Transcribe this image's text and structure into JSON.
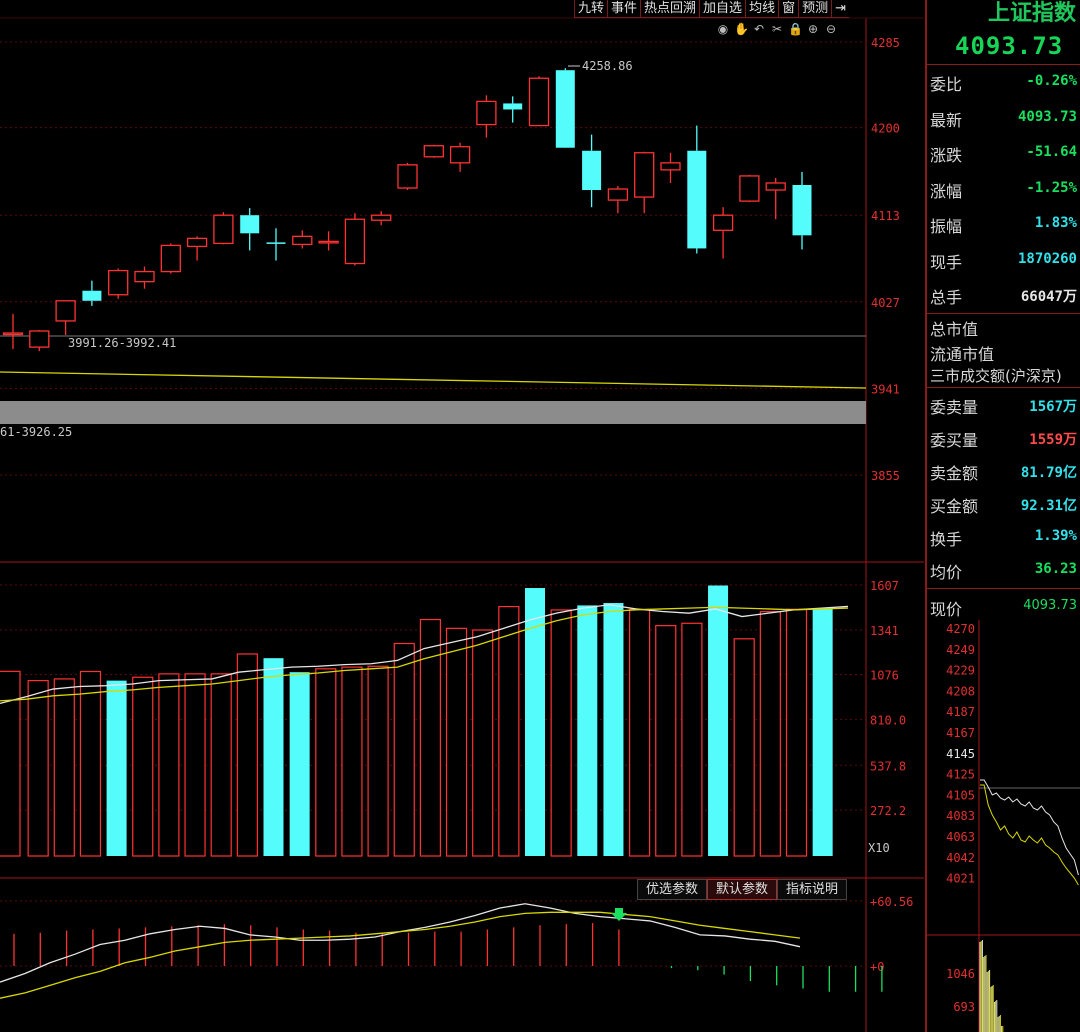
{
  "toolbar": {
    "buttons": [
      "九转",
      "事件",
      "热点回溯",
      "加自选",
      "均线",
      "窗",
      "预测"
    ],
    "arrow": "⇥"
  },
  "zoom_tools": [
    "eye-icon",
    "hand-icon",
    "undo-icon",
    "scissors-icon",
    "lock-icon",
    "zoom-in-icon",
    "zoom-out-icon"
  ],
  "main_axis_labels": [
    "4285",
    "4200",
    "4113",
    "4027",
    "3941",
    "3855"
  ],
  "annotations": {
    "high": "4258.86",
    "gap1": "3991.26-3992.41",
    "gap2": "61-3926.25"
  },
  "volume_axis_labels": [
    "1607",
    "1341",
    "1076",
    "810.0",
    "537.8",
    "272.2"
  ],
  "volume_unit": "X10",
  "macd_axis_labels": [
    "+60.56",
    "+0"
  ],
  "param_buttons": [
    "优选参数",
    "默认参数",
    "指标说明"
  ],
  "chart_data": {
    "type": "candlestick",
    "price_range": [
      3799,
      4310
    ],
    "candles": [
      {
        "o": 3996,
        "h": 4015,
        "l": 3980,
        "c": 3996
      },
      {
        "o": 3998,
        "h": 3999,
        "l": 3978,
        "c": 3982
      },
      {
        "o": 4008,
        "h": 4028,
        "l": 3994,
        "c": 4028
      },
      {
        "o": 4028,
        "h": 4048,
        "l": 4023,
        "c": 4038,
        "color": "cyan"
      },
      {
        "o": 4034,
        "h": 4060,
        "l": 4030,
        "c": 4058
      },
      {
        "o": 4047,
        "h": 4062,
        "l": 4040,
        "c": 4057
      },
      {
        "o": 4057,
        "h": 4085,
        "l": 4055,
        "c": 4083
      },
      {
        "o": 4082,
        "h": 4092,
        "l": 4068,
        "c": 4090
      },
      {
        "o": 4085,
        "h": 4116,
        "l": 4084,
        "c": 4113
      },
      {
        "o": 4113,
        "h": 4120,
        "l": 4078,
        "c": 4095,
        "color": "cyan"
      },
      {
        "o": 4086,
        "h": 4100,
        "l": 4068,
        "c": 4086,
        "color": "cyan"
      },
      {
        "o": 4084,
        "h": 4098,
        "l": 4080,
        "c": 4092
      },
      {
        "o": 4086,
        "h": 4097,
        "l": 4078,
        "c": 4087
      },
      {
        "o": 4065,
        "h": 4115,
        "l": 4063,
        "c": 4109
      },
      {
        "o": 4108,
        "h": 4117,
        "l": 4103,
        "c": 4113
      },
      {
        "o": 4140,
        "h": 4165,
        "l": 4138,
        "c": 4163
      },
      {
        "o": 4171,
        "h": 4183,
        "l": 4170,
        "c": 4182
      },
      {
        "o": 4165,
        "h": 4185,
        "l": 4156,
        "c": 4181
      },
      {
        "o": 4203,
        "h": 4232,
        "l": 4190,
        "c": 4226
      },
      {
        "o": 4224,
        "h": 4231,
        "l": 4205,
        "c": 4218,
        "color": "cyan"
      },
      {
        "o": 4202,
        "h": 4251,
        "l": 4202,
        "c": 4249
      },
      {
        "o": 4257,
        "h": 4259,
        "l": 4185,
        "c": 4180,
        "color": "cyan"
      },
      {
        "o": 4177,
        "h": 4193,
        "l": 4121,
        "c": 4138,
        "color": "cyan"
      },
      {
        "o": 4128,
        "h": 4142,
        "l": 4115,
        "c": 4139
      },
      {
        "o": 4131,
        "h": 4176,
        "l": 4115,
        "c": 4175
      },
      {
        "o": 4158,
        "h": 4175,
        "l": 4145,
        "c": 4165
      },
      {
        "o": 4177,
        "h": 4202,
        "l": 4075,
        "c": 4080,
        "color": "cyan"
      },
      {
        "o": 4098,
        "h": 4121,
        "l": 4070,
        "c": 4113
      },
      {
        "o": 4127,
        "h": 4153,
        "l": 4126,
        "c": 4152
      },
      {
        "o": 4138,
        "h": 4150,
        "l": 4109,
        "c": 4145
      },
      {
        "o": 4143,
        "h": 4156,
        "l": 4079,
        "c": 4093,
        "color": "cyan"
      }
    ],
    "volumes": [
      1095,
      1040,
      1050,
      1094,
      1040,
      1060,
      1080,
      1080,
      1080,
      1198,
      1173,
      1090,
      1110,
      1120,
      1125,
      1260,
      1402,
      1350,
      1340,
      1479,
      1589,
      1459,
      1486,
      1500,
      1462,
      1366,
      1380,
      1604,
      1288,
      1449,
      1463,
      1467
    ],
    "volume_range": [
      0,
      1607
    ],
    "macd_hist": [
      30,
      31,
      33,
      34,
      35,
      36,
      37,
      38,
      39,
      38,
      36,
      34,
      33,
      31,
      31,
      31,
      32,
      32,
      34,
      36,
      38,
      39,
      40,
      34,
      0,
      -2,
      -4,
      -8,
      -14,
      -18,
      -21,
      -24,
      -24,
      -24
    ],
    "macd_dif": [
      -15,
      -7,
      3,
      11,
      20,
      24,
      30,
      34,
      37,
      35,
      29,
      27,
      24,
      24,
      25,
      27,
      32,
      36,
      41,
      47,
      54,
      58,
      54,
      49,
      46,
      44,
      42,
      36,
      29,
      28,
      25,
      23,
      18
    ],
    "macd_dea": [
      -30,
      -25,
      -18,
      -11,
      -5,
      3,
      8,
      14,
      18,
      22,
      24,
      25,
      26,
      27,
      28,
      30,
      32,
      34,
      37,
      41,
      46,
      49,
      50,
      50,
      50,
      48,
      46,
      42,
      38,
      35,
      32,
      29,
      26
    ],
    "macd_range": [
      -60,
      70
    ]
  },
  "right_panel": {
    "name": "上证指数",
    "price": "4093.73",
    "rows": [
      {
        "label": "委比",
        "value": "-0.26%",
        "color": "green"
      },
      {
        "label": "最新",
        "value": "4093.73",
        "color": "green"
      },
      {
        "label": "涨跌",
        "value": "-51.64",
        "color": "green"
      },
      {
        "label": "涨幅",
        "value": "-1.25%",
        "color": "green"
      },
      {
        "label": "振幅",
        "value": "1.83%",
        "color": "cyan"
      },
      {
        "label": "现手",
        "value": "1870260",
        "color": "cyan"
      },
      {
        "label": "总手",
        "value": "66047万",
        "color": "white"
      }
    ],
    "info_labels": [
      "总市值",
      "流通市值",
      "三市成交额(沪深京)"
    ],
    "rows2": [
      {
        "label": "委卖量",
        "value": "1567万",
        "color": "cyan"
      },
      {
        "label": "委买量",
        "value": "1559万",
        "color": "red"
      },
      {
        "label": "卖金额",
        "value": "81.79亿",
        "color": "cyan"
      },
      {
        "label": "买金额",
        "value": "92.31亿",
        "color": "cyan"
      },
      {
        "label": "换手",
        "value": "1.39%",
        "color": "cyan"
      },
      {
        "label": "均价",
        "value": "36.23",
        "color": "green"
      }
    ],
    "mini_chart": {
      "label": "现价",
      "value": "4093.73",
      "price_labels": [
        "4270",
        "4249",
        "4229",
        "4208",
        "4187",
        "4167",
        "4145",
        "4125",
        "4105",
        "4083",
        "4063",
        "4042",
        "4021"
      ],
      "vol_labels": [
        "1046",
        "693"
      ]
    }
  }
}
